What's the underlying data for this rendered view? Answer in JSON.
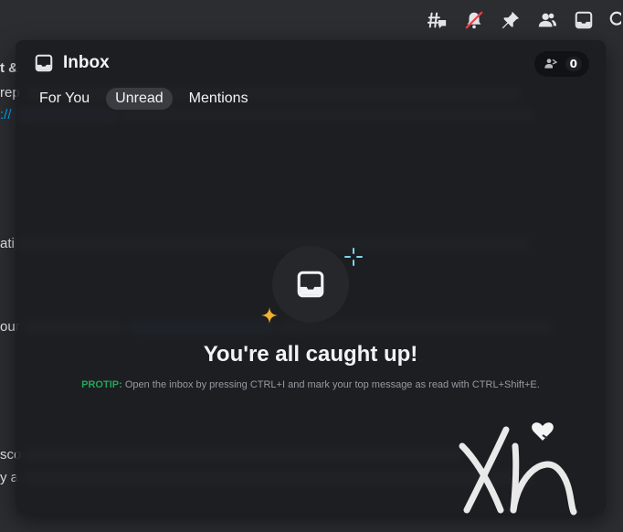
{
  "toolbar": {
    "icons": [
      "threads-icon",
      "mute-icon",
      "pin-icon",
      "members-icon",
      "inbox-icon",
      "search-icon"
    ]
  },
  "background": {
    "fragments": [
      "t &",
      "rep",
      "://",
      "ati",
      "our",
      "sco",
      "y a"
    ]
  },
  "inbox": {
    "title": "Inbox",
    "mention_count": "0",
    "tabs": [
      {
        "label": "For You",
        "active": false
      },
      {
        "label": "Unread",
        "active": true
      },
      {
        "label": "Mentions",
        "active": false
      }
    ],
    "empty_title": "You're all caught up!",
    "protip_label": "PROTIP:",
    "protip_text": "Open the inbox by pressing CTRL+I and mark your top message as read with CTRL+Shift+E."
  },
  "colors": {
    "accent_green": "#23a55a",
    "link_blue": "#00a8fc",
    "sparkle_yellow": "#f0b232",
    "sparkle_blue": "#7ad6f5",
    "muted_red": "#f23f43"
  }
}
